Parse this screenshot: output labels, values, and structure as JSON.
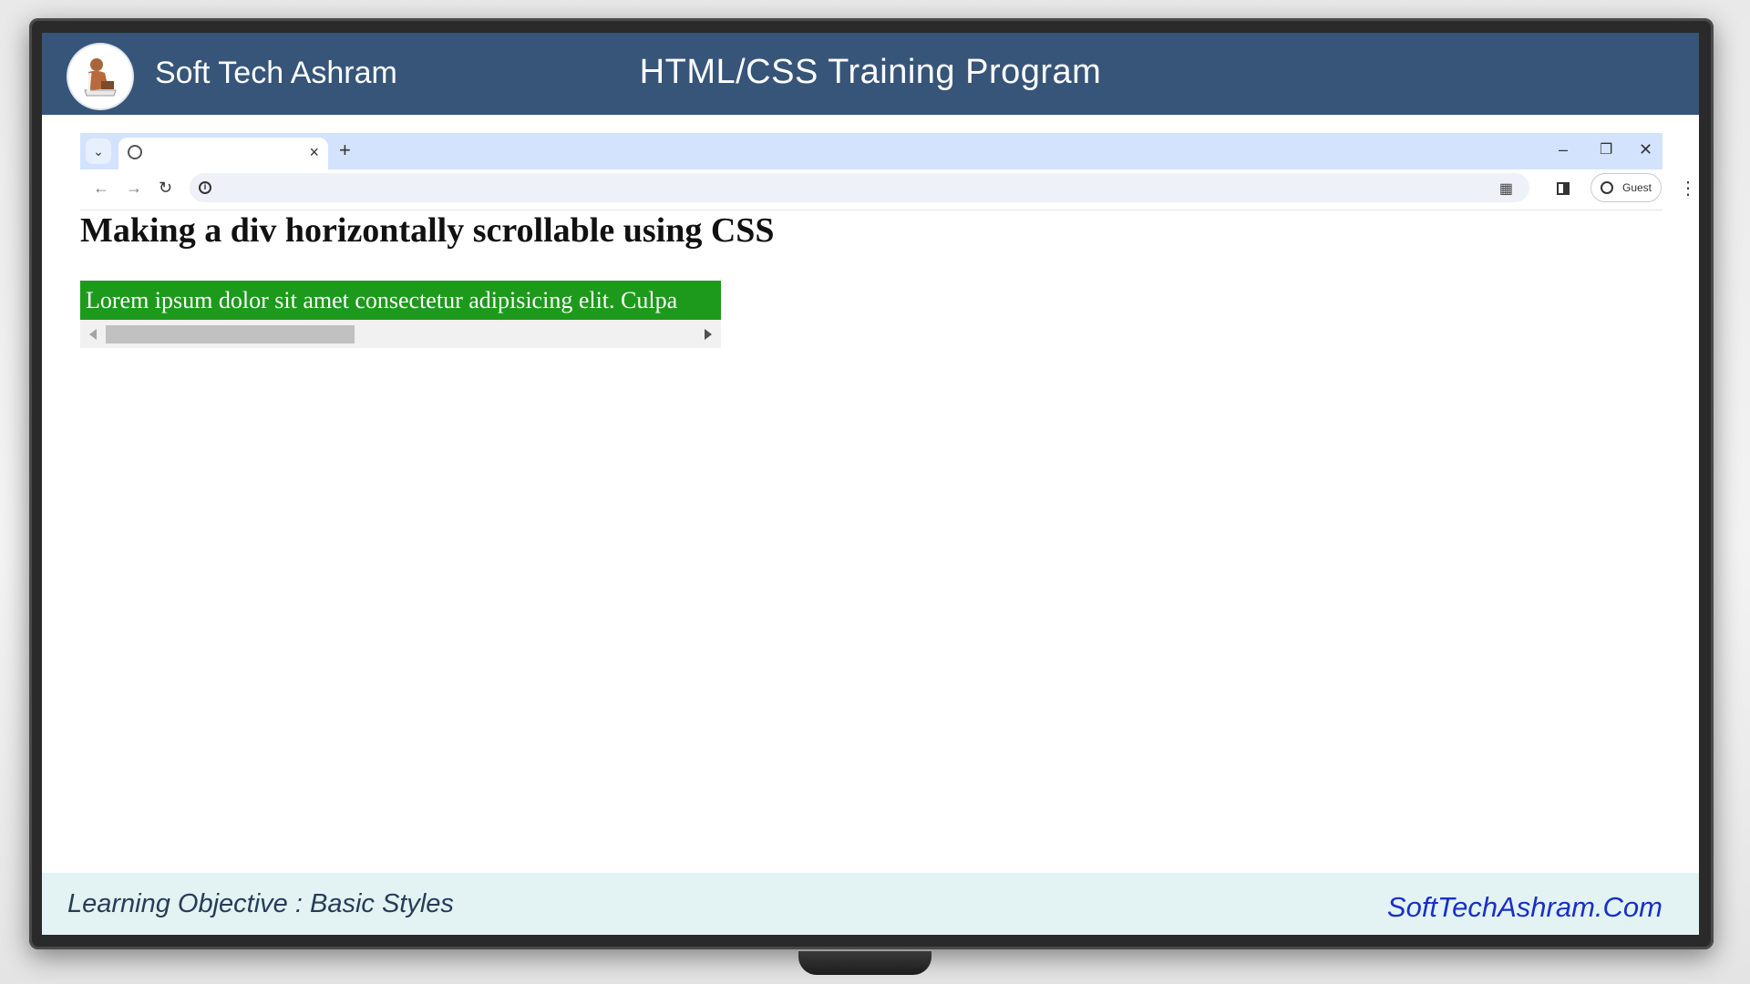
{
  "banner": {
    "brand": "Soft Tech Ashram",
    "title": "HTML/CSS Training Program"
  },
  "browser": {
    "tab": {
      "title": "",
      "close": "×"
    },
    "new_tab": "+",
    "window_controls": {
      "minimize": "–",
      "restore": "❐",
      "close": "✕"
    },
    "nav": {
      "back": "←",
      "forward": "→",
      "reload": "↻"
    },
    "address": "",
    "profile_label": "Guest",
    "menu": "⋮"
  },
  "page": {
    "heading": "Making a div horizontally scrollable using CSS",
    "scroll_text": "Lorem ipsum dolor sit amet consectetur adipisicing elit. Culpa",
    "scroll_fraction": 0.0
  },
  "footer": {
    "objective": "Learning Objective :  Basic Styles",
    "site": "SoftTechAshram.Com"
  },
  "colors": {
    "banner": "#375579",
    "scroll_box_bg": "#1d9a1b",
    "footer_bg": "#e3f3f3",
    "site_link": "#1830c8"
  }
}
